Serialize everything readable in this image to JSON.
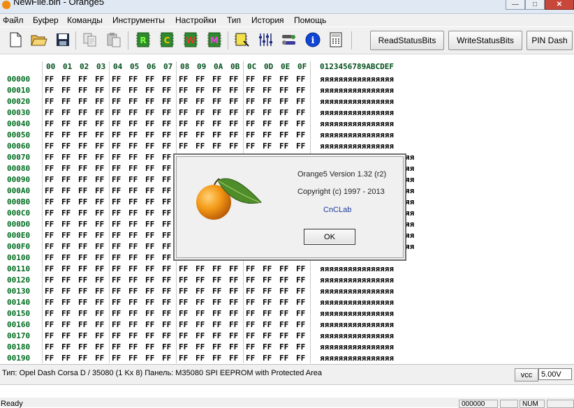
{
  "window": {
    "title": "NewFile.bin - Orange5",
    "controls": [
      "—",
      "□",
      "✕"
    ]
  },
  "menu": [
    "Файл",
    "Буфер",
    "Команды",
    "Инструменты",
    "Настройки",
    "Тип",
    "История",
    "Помощь"
  ],
  "toolbar": {
    "icons": [
      "new-file-icon",
      "open-folder-icon",
      "save-icon",
      "copy-icon",
      "paste-icon",
      "read-chip-icon",
      "compare-chip-icon",
      "write-chip-icon",
      "modify-chip-icon",
      "buffer-icon",
      "adjust-icon",
      "tools-icon",
      "info-icon",
      "calculator-icon"
    ],
    "chip_labels": {
      "read": "R",
      "compare": "C",
      "write": "W",
      "modify": "M"
    },
    "info_label": "i",
    "buttons": [
      "ReadStatusBits",
      "WriteStatusBits",
      "PIN Dash"
    ]
  },
  "hex": {
    "header_bytes": [
      "00",
      "01",
      "02",
      "03",
      "04",
      "05",
      "06",
      "07",
      "08",
      "09",
      "0A",
      "0B",
      "0C",
      "0D",
      "0E",
      "0F"
    ],
    "header_ascii": "0123456789ABCDEF",
    "addresses": [
      "00000",
      "00010",
      "00020",
      "00030",
      "00040",
      "00050",
      "00060",
      "00070",
      "00080",
      "00090",
      "000A0",
      "000B0",
      "000C0",
      "000D0",
      "000E0",
      "000F0",
      "00100",
      "00110",
      "00120",
      "00130",
      "00140",
      "00150",
      "00160",
      "00170",
      "00180",
      "00190"
    ],
    "byte_value": "FF",
    "ascii_row": "яяяяяяяяяяяяяяяя",
    "ascii_partial": "яя"
  },
  "dialog": {
    "version": "Orange5  Version 1.32 (r2)",
    "copyright": "Copyright (c) 1997 - 2013",
    "company": "CnCLab",
    "ok_label": "OK"
  },
  "status": {
    "info": "Тип: Opel Dash Corsa D / 35080 (1 Kx 8)   Панель: M35080   SPI EEPROM with Protected Area",
    "vcc_label": "vcc",
    "voltage": "5.00V",
    "ready": "Ready",
    "offset": "000000",
    "num": "NUM"
  },
  "colors": {
    "address_green": "#006b1f",
    "link_blue": "#1a3c9c",
    "menu_bg": "#f0f0f0"
  }
}
